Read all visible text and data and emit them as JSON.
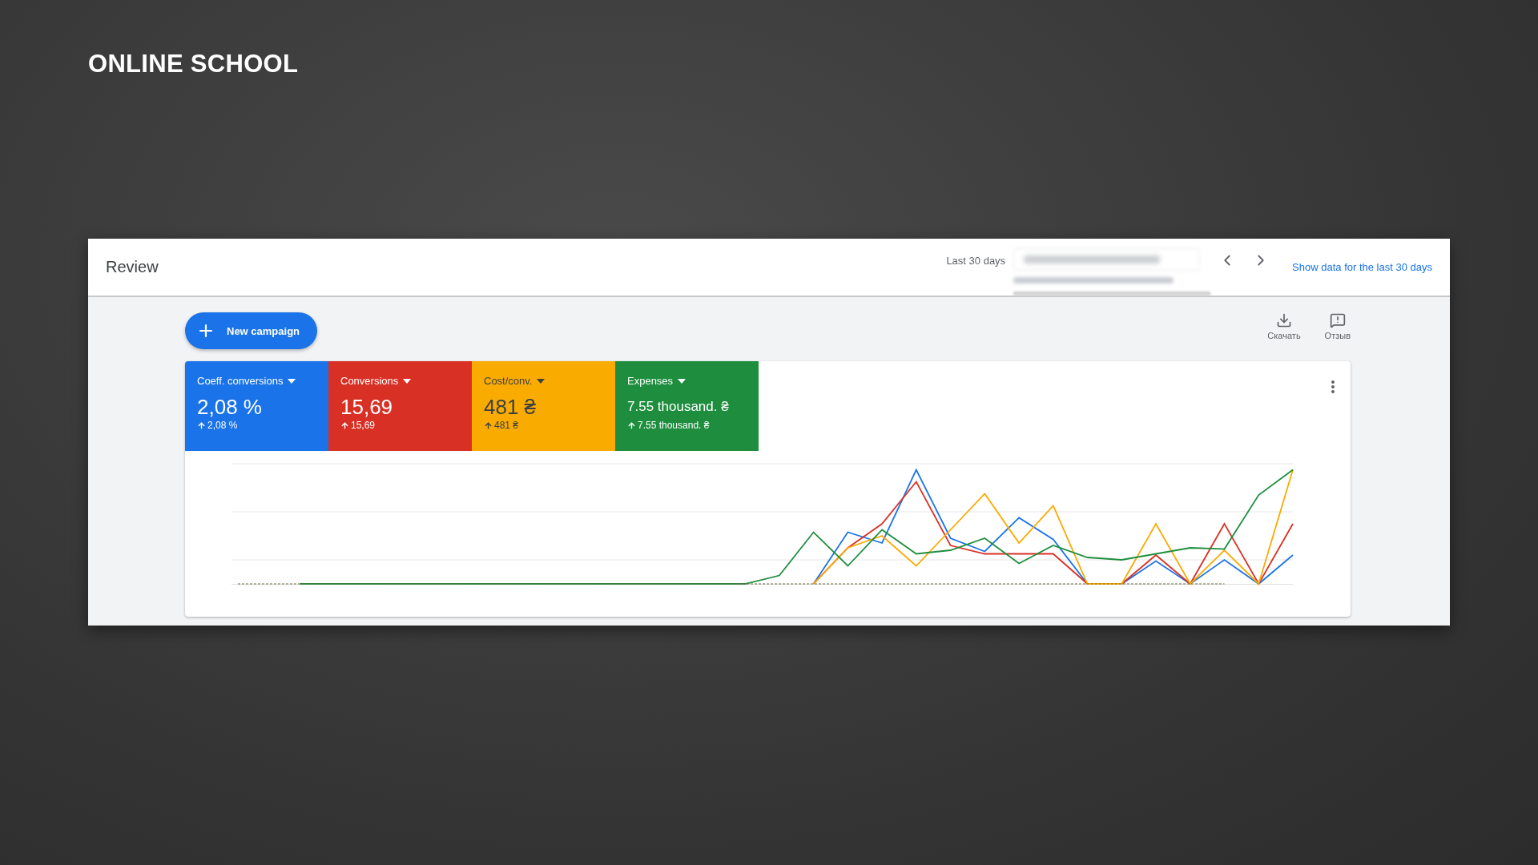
{
  "slide": {
    "title": "ONLINE SCHOOL"
  },
  "header": {
    "title": "Review",
    "range_label": "Last 30 days",
    "link": "Show data for the last 30 days"
  },
  "toolbar": {
    "new_button": "New campaign",
    "actions": [
      {
        "kind": "download",
        "label": "Скачать"
      },
      {
        "kind": "feedback",
        "label": "Отзыв"
      }
    ]
  },
  "metrics": [
    {
      "label": "Coeff. conversions",
      "value": "2,08 %",
      "delta": "2,08 %",
      "color": "#1a73e8",
      "selected": true
    },
    {
      "label": "Conversions",
      "value": "15,69",
      "delta": "15,69",
      "color": "#d93025",
      "selected": true
    },
    {
      "label": "Cost/conv.",
      "value": "481 ₴",
      "delta": "481 ₴",
      "color": "#f9ab00",
      "selected": true
    },
    {
      "label": "Expenses",
      "value": "7.55 thousand. ₴",
      "delta": "7.55 thousand. ₴",
      "color": "#1e8e3e",
      "selected": true
    }
  ]
}
